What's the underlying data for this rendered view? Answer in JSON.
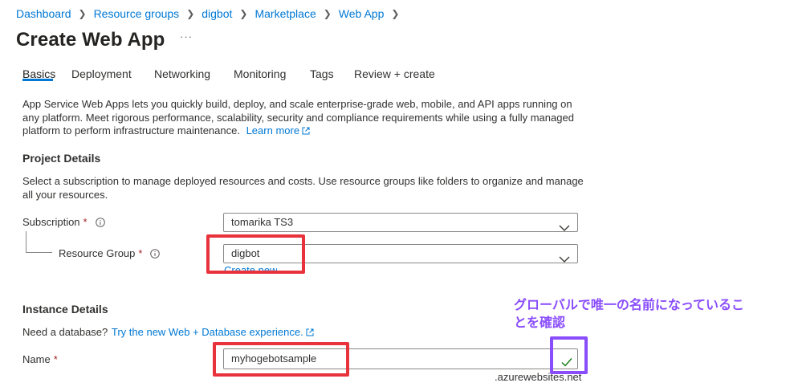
{
  "breadcrumb": [
    "Dashboard",
    "Resource groups",
    "digbot",
    "Marketplace",
    "Web App"
  ],
  "page": {
    "title": "Create Web App",
    "more": "···"
  },
  "tabs": [
    "Basics",
    "Deployment",
    "Networking",
    "Monitoring",
    "Tags",
    "Review + create"
  ],
  "active_tab": "Basics",
  "intro": {
    "text": "App Service Web Apps lets you quickly build, deploy, and scale enterprise-grade web, mobile, and API apps running on any platform. Meet rigorous performance, scalability, security and compliance requirements while using a fully managed platform to perform infrastructure maintenance.",
    "learn_more": "Learn more"
  },
  "project": {
    "title": "Project Details",
    "description": "Select a subscription to manage deployed resources and costs. Use resource groups like folders to organize and manage all your resources.",
    "subscription_label": "Subscription",
    "subscription_value": "tomarika TS3",
    "resource_group_label": "Resource Group",
    "resource_group_value": "digbot",
    "create_new": "Create new"
  },
  "instance": {
    "title": "Instance Details",
    "db_prompt": "Need a database?",
    "db_link": "Try the new Web + Database experience.",
    "name_label": "Name",
    "name_value": "myhogebotsample",
    "name_suffix": ".azurewebsites.net"
  },
  "annotation": {
    "note": "グローバルで唯一の名前になっていることを確認"
  },
  "colors": {
    "link": "#0078d4",
    "required": "#a4262c",
    "annotation_red": "#e8323c",
    "annotation_purple": "#8a4dfb",
    "valid_check": "#107c10"
  },
  "icons": [
    "chevron-right-icon",
    "info-icon",
    "chevron-down-icon",
    "external-link-icon",
    "checkmark-icon"
  ]
}
